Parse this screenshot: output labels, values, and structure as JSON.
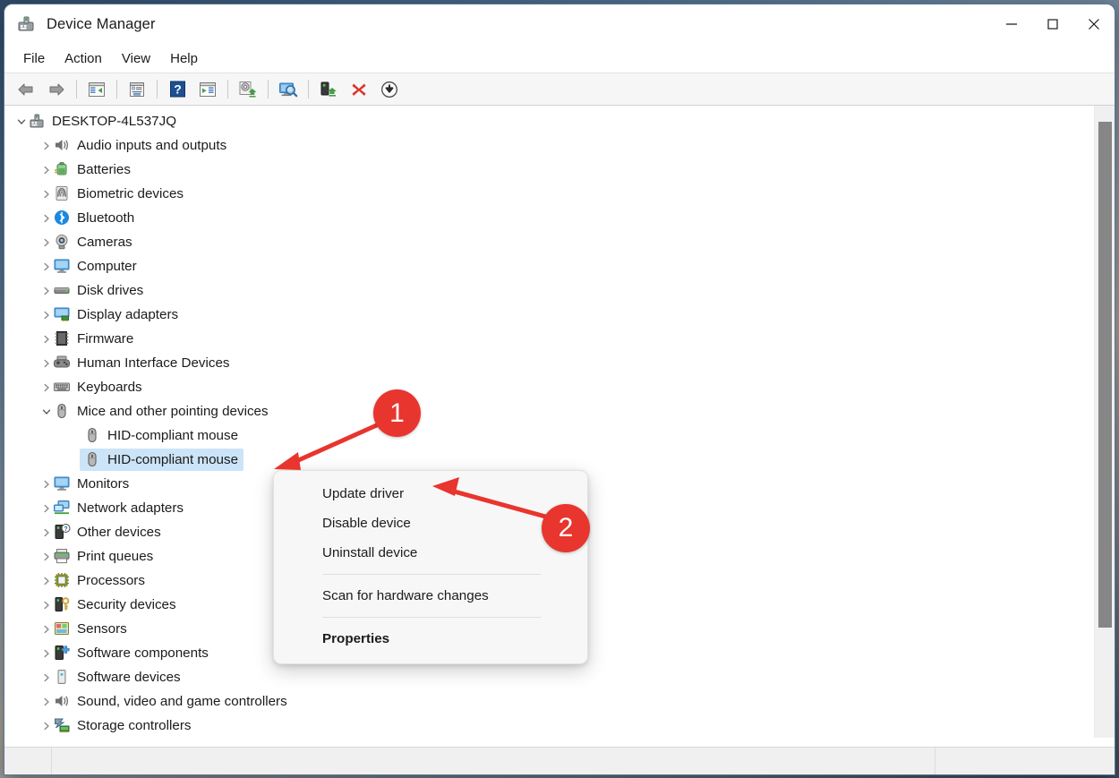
{
  "window": {
    "title": "Device Manager",
    "app_icon": "device-manager-icon",
    "minimize_label": "Minimize",
    "maximize_label": "Maximize",
    "close_label": "Close"
  },
  "menubar": {
    "items": [
      {
        "label": "File"
      },
      {
        "label": "Action"
      },
      {
        "label": "View"
      },
      {
        "label": "Help"
      }
    ]
  },
  "toolbar": {
    "buttons": [
      {
        "name": "back-button",
        "icon": "back-arrow-icon"
      },
      {
        "name": "forward-button",
        "icon": "forward-arrow-icon"
      },
      {
        "name": "show-hide-console-tree-button",
        "icon": "console-tree-icon"
      },
      {
        "name": "properties-button",
        "icon": "properties-window-icon"
      },
      {
        "name": "help-button",
        "icon": "question-mark-icon"
      },
      {
        "name": "show-hide-action-pane-button",
        "icon": "action-pane-icon"
      },
      {
        "name": "update-driver-button",
        "icon": "update-driver-icon"
      },
      {
        "name": "scan-for-hardware-changes-button",
        "icon": "scan-hardware-icon"
      },
      {
        "name": "enable-device-button",
        "icon": "enable-device-icon"
      },
      {
        "name": "uninstall-device-button",
        "icon": "red-x-icon"
      },
      {
        "name": "disable-device-button",
        "icon": "down-arrow-circle-icon"
      }
    ]
  },
  "tree": {
    "root": {
      "label": "DESKTOP-4L537JQ",
      "icon": "computer-root-icon",
      "expanded": true
    },
    "nodes": [
      {
        "label": "Audio inputs and outputs",
        "icon": "speaker-icon",
        "expanded": false,
        "level": 1
      },
      {
        "label": "Batteries",
        "icon": "battery-icon",
        "expanded": false,
        "level": 1
      },
      {
        "label": "Biometric devices",
        "icon": "fingerprint-icon",
        "expanded": false,
        "level": 1
      },
      {
        "label": "Bluetooth",
        "icon": "bluetooth-icon",
        "expanded": false,
        "level": 1
      },
      {
        "label": "Cameras",
        "icon": "camera-icon",
        "expanded": false,
        "level": 1
      },
      {
        "label": "Computer",
        "icon": "monitor-icon",
        "expanded": false,
        "level": 1
      },
      {
        "label": "Disk drives",
        "icon": "disk-drive-icon",
        "expanded": false,
        "level": 1
      },
      {
        "label": "Display adapters",
        "icon": "display-adapter-icon",
        "expanded": false,
        "level": 1
      },
      {
        "label": "Firmware",
        "icon": "firmware-chip-icon",
        "expanded": false,
        "level": 1
      },
      {
        "label": "Human Interface Devices",
        "icon": "gamepad-icon",
        "expanded": false,
        "level": 1
      },
      {
        "label": "Keyboards",
        "icon": "keyboard-icon",
        "expanded": false,
        "level": 1
      },
      {
        "label": "Mice and other pointing devices",
        "icon": "mouse-icon",
        "expanded": true,
        "level": 1
      },
      {
        "label": "HID-compliant mouse",
        "icon": "mouse-icon",
        "leaf": true,
        "level": 2,
        "selected": false
      },
      {
        "label": "HID-compliant mouse",
        "icon": "mouse-icon",
        "leaf": true,
        "level": 2,
        "selected": true
      },
      {
        "label": "Monitors",
        "icon": "monitor-icon",
        "expanded": false,
        "level": 1
      },
      {
        "label": "Network adapters",
        "icon": "network-adapter-icon",
        "expanded": false,
        "level": 1
      },
      {
        "label": "Other devices",
        "icon": "unknown-device-icon",
        "expanded": false,
        "level": 1
      },
      {
        "label": "Print queues",
        "icon": "printer-icon",
        "expanded": false,
        "level": 1
      },
      {
        "label": "Processors",
        "icon": "processor-icon",
        "expanded": false,
        "level": 1
      },
      {
        "label": "Security devices",
        "icon": "security-key-icon",
        "expanded": false,
        "level": 1
      },
      {
        "label": "Sensors",
        "icon": "sensors-icon",
        "expanded": false,
        "level": 1
      },
      {
        "label": "Software components",
        "icon": "software-component-icon",
        "expanded": false,
        "level": 1
      },
      {
        "label": "Software devices",
        "icon": "software-device-icon",
        "expanded": false,
        "level": 1
      },
      {
        "label": "Sound, video and game controllers",
        "icon": "speaker-icon",
        "expanded": false,
        "level": 1
      },
      {
        "label": "Storage controllers",
        "icon": "storage-controller-icon",
        "expanded": false,
        "level": 1
      }
    ]
  },
  "context_menu": {
    "items": [
      {
        "label": "Update driver",
        "bold": false
      },
      {
        "label": "Disable device",
        "bold": false
      },
      {
        "label": "Uninstall device",
        "bold": false
      },
      {
        "separator": true
      },
      {
        "label": "Scan for hardware changes",
        "bold": false
      },
      {
        "separator": true
      },
      {
        "label": "Properties",
        "bold": true
      }
    ]
  },
  "annotations": {
    "badges": [
      {
        "label": "1",
        "color": "#e8352e"
      },
      {
        "label": "2",
        "color": "#e8352e"
      }
    ]
  },
  "statusbar": {
    "text": ""
  },
  "colors": {
    "selection": "#cce4f7",
    "accent_red": "#e8352e",
    "window_bg": "#ffffff",
    "toolbar_bg": "#f6f6f6",
    "statusbar_bg": "#f0f0f0"
  }
}
